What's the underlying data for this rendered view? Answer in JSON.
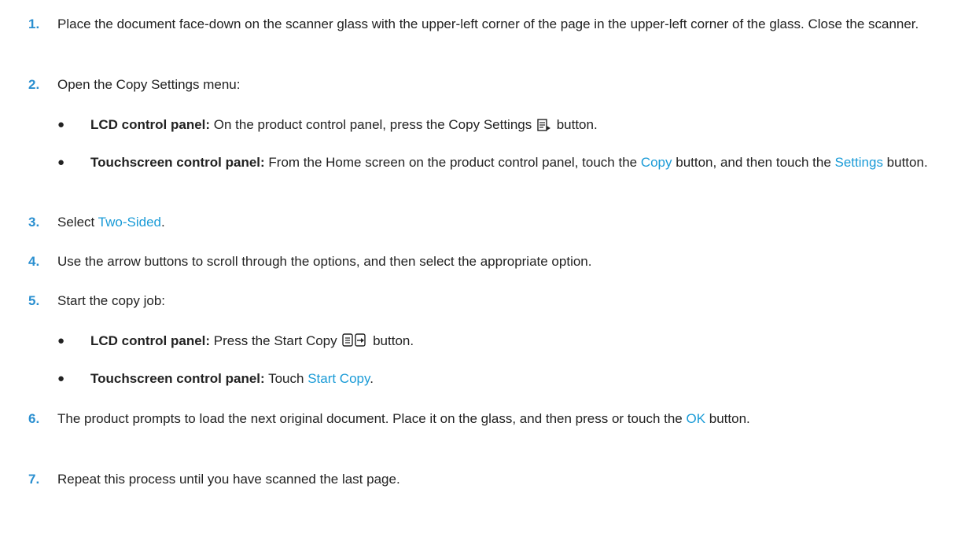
{
  "steps": [
    {
      "num": "1.",
      "text": "Place the document face-down on the scanner glass with the upper-left corner of the page in the upper-left corner of the glass. Close the scanner."
    },
    {
      "num": "2.",
      "text": "Open the Copy Settings menu:"
    },
    {
      "num": "3.",
      "pre": "Select ",
      "ui": "Two-Sided",
      "post": "."
    },
    {
      "num": "4.",
      "text": "Use the arrow buttons to scroll through the options, and then select the appropriate option."
    },
    {
      "num": "5.",
      "text": "Start the copy job:"
    },
    {
      "num": "6.",
      "pre": "The product prompts to load the next original document. Place it on the glass, and then press or touch the ",
      "ui": "OK",
      "post": " button."
    },
    {
      "num": "7.",
      "text": "Repeat this process until you have scanned the last page."
    }
  ],
  "step2_bullets": {
    "lcd": {
      "label": "LCD control panel:",
      "pre": " On the product control panel, press the Copy Settings ",
      "post": " button.",
      "icon": "copy-settings-icon"
    },
    "touch": {
      "label": "Touchscreen control panel:",
      "pre": " From the Home screen on the product control panel, touch the ",
      "ui1": "Copy",
      "mid": " button, and then touch the ",
      "ui2": "Settings",
      "post": " button."
    }
  },
  "step5_bullets": {
    "lcd": {
      "label": "LCD control panel:",
      "pre": " Press the Start Copy ",
      "post": " button.",
      "icon": "start-copy-icon"
    },
    "touch": {
      "label": "Touchscreen control panel:",
      "pre": " Touch ",
      "ui": "Start Copy",
      "post": "."
    }
  },
  "bullet_char": "●",
  "colors": {
    "step_number": "#2a8fd0",
    "ui_term": "#1a9bd7",
    "body_text": "#222222"
  }
}
